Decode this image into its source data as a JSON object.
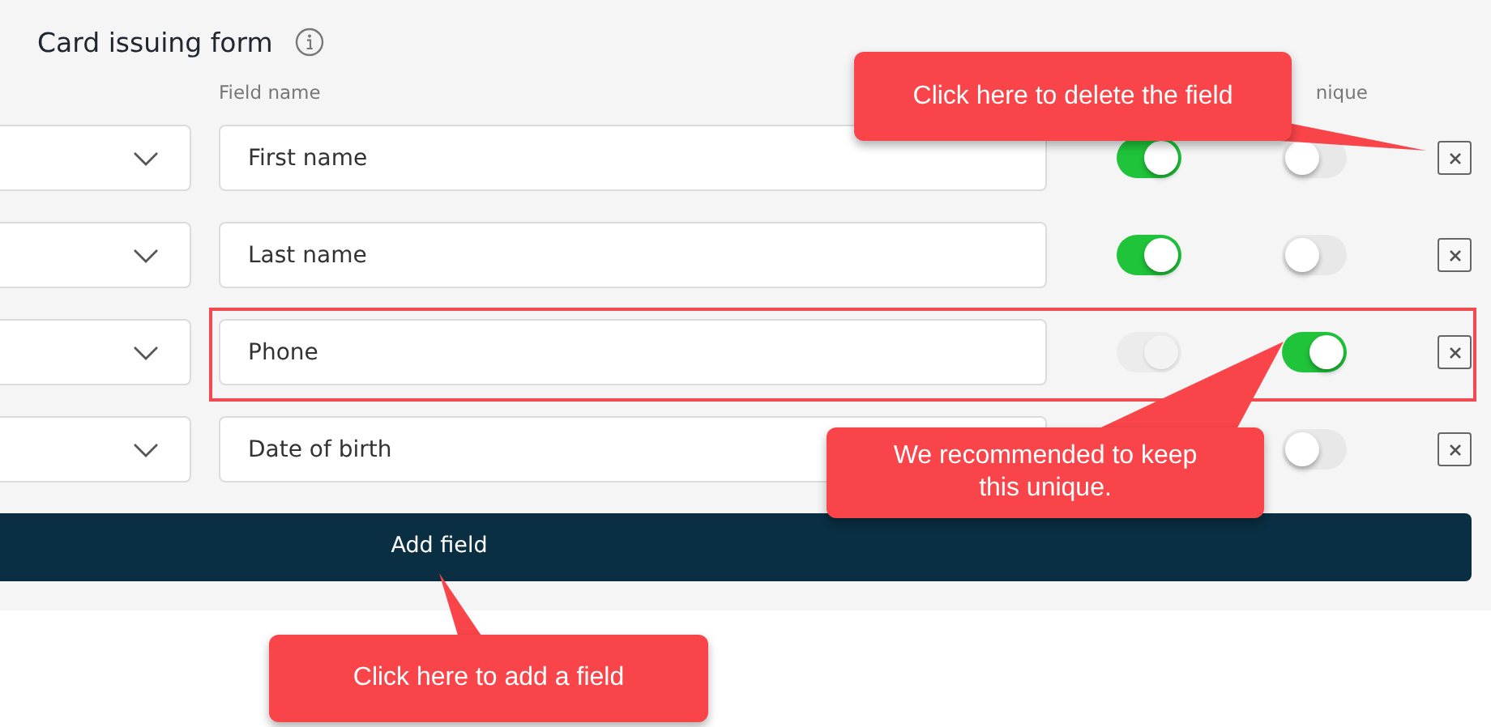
{
  "form": {
    "title": "Card issuing form",
    "columns": [
      "Field name",
      "nique"
    ],
    "rows": [
      {
        "name": "First name",
        "required": {
          "on": true,
          "disabled": false
        },
        "unique": {
          "on": false
        },
        "highlighted": false
      },
      {
        "name": "Last name",
        "required": {
          "on": true,
          "disabled": false
        },
        "unique": {
          "on": false
        },
        "highlighted": false
      },
      {
        "name": "Phone",
        "required": {
          "on": true,
          "disabled": true
        },
        "unique": {
          "on": true
        },
        "highlighted": true
      },
      {
        "name": "Date of birth",
        "unique": {
          "on": false
        },
        "highlighted": false
      }
    ],
    "add_button": "Add field"
  },
  "callouts": [
    {
      "kind": "delete",
      "text": "Click here to delete the field"
    },
    {
      "kind": "unique",
      "text": "We recommended to keep this unique."
    },
    {
      "kind": "add",
      "text": "Click here to add a field"
    }
  ]
}
